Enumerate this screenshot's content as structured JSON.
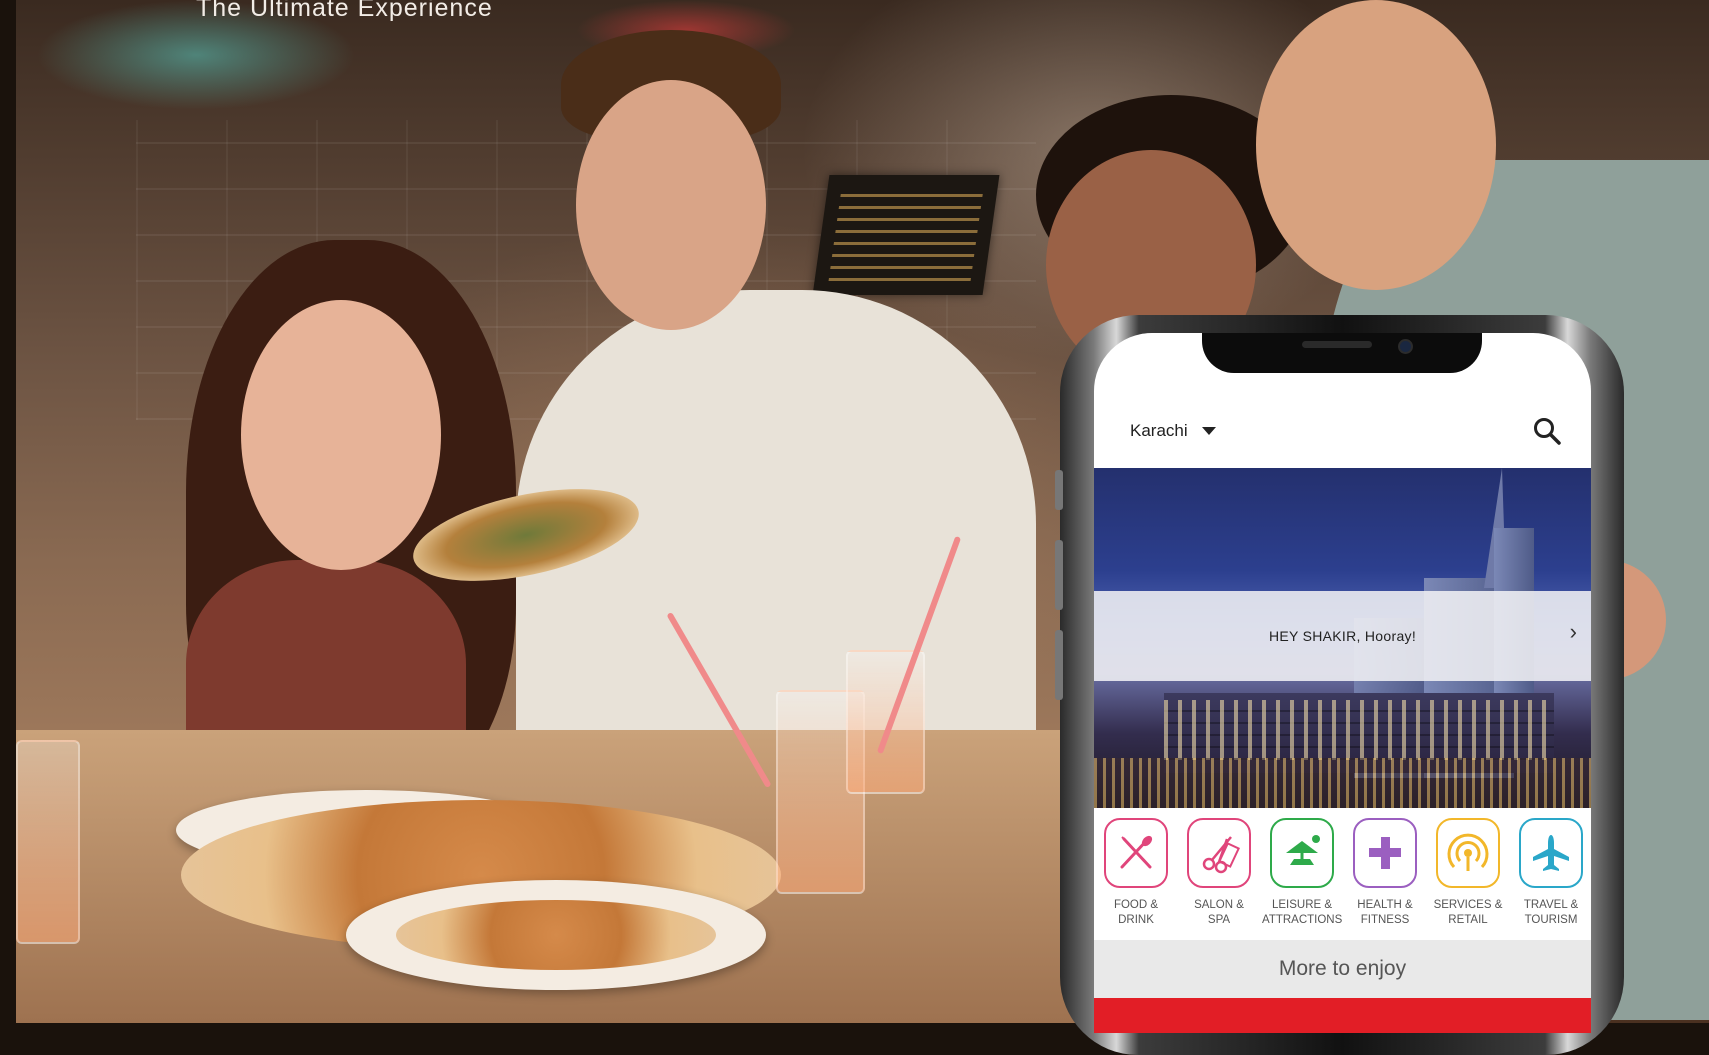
{
  "hero": {
    "tagline": "The Ultimate Experience"
  },
  "app": {
    "city_selector": {
      "value": "Karachi"
    },
    "banner": {
      "greeting": "HEY SHAKIR, Hooray!"
    },
    "categories": [
      {
        "label": "FOOD &\nDRINK",
        "icon": "fork-knife-icon",
        "color": "#e0457b"
      },
      {
        "label": "SALON &\nSPA",
        "icon": "scissors-comb-icon",
        "color": "#e0457b"
      },
      {
        "label": "LEISURE &\nATTRACTIONS",
        "icon": "beach-chair-icon",
        "color": "#2eaa4a"
      },
      {
        "label": "HEALTH &\nFITNESS",
        "icon": "plus-icon",
        "color": "#9b5fc0"
      },
      {
        "label": "SERVICES &\nRETAIL",
        "icon": "signal-icon",
        "color": "#f2b72a"
      },
      {
        "label": "TRAVEL &\nTOURISM",
        "icon": "airplane-icon",
        "color": "#2aa7c9"
      }
    ],
    "more_button": "More to enjoy",
    "accent_color": "#e21e26"
  }
}
